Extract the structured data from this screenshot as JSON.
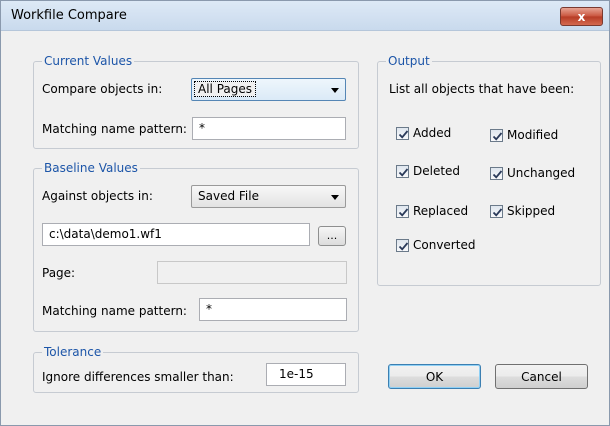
{
  "window": {
    "title": "Workfile Compare",
    "close_glyph": "x"
  },
  "current_values": {
    "legend": "Current Values",
    "compare_label": "Compare objects in:",
    "compare_value": "All Pages",
    "pattern_label": "Matching name pattern:",
    "pattern_value": "*"
  },
  "baseline_values": {
    "legend": "Baseline Values",
    "against_label": "Against objects in:",
    "against_value": "Saved File",
    "file_path": "c:\\data\\demo1.wf1",
    "browse_label": "...",
    "page_label": "Page:",
    "page_value": "",
    "pattern_label": "Matching name pattern:",
    "pattern_value": "*"
  },
  "tolerance": {
    "legend": "Tolerance",
    "label": "Ignore differences smaller than:",
    "value": "1e-15"
  },
  "output": {
    "legend": "Output",
    "description": "List all objects that have been:",
    "checkboxes": [
      {
        "label": "Added",
        "checked": true
      },
      {
        "label": "Modified",
        "checked": true
      },
      {
        "label": "Deleted",
        "checked": true
      },
      {
        "label": "Unchanged",
        "checked": true
      },
      {
        "label": "Replaced",
        "checked": true
      },
      {
        "label": "Skipped",
        "checked": true
      },
      {
        "label": "Converted",
        "checked": true
      }
    ]
  },
  "buttons": {
    "ok": "OK",
    "cancel": "Cancel"
  },
  "colors": {
    "group_legend": "#1c55a8",
    "close_button": "#c8533c",
    "dialog_bg": "#f0f0f0"
  }
}
